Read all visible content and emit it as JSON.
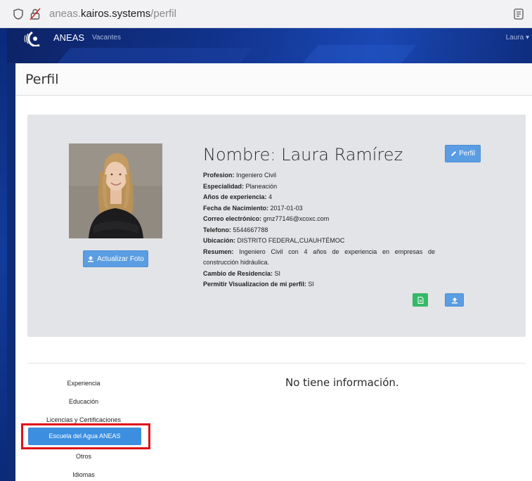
{
  "browser": {
    "url_prefix": "aneas.",
    "url_domain": "kairos.systems",
    "url_path": "/perfil"
  },
  "nav": {
    "brand": "ANEAS",
    "link": "Vacantes",
    "user": "Laura"
  },
  "page": {
    "title": "Perfil"
  },
  "profile": {
    "name": "Nombre: Laura Ramírez",
    "fields": [
      {
        "label": "Profesion:",
        "value": "Ingeniero Civil"
      },
      {
        "label": "Especialidad:",
        "value": "Planeación"
      },
      {
        "label": "Años de experiencia:",
        "value": "4"
      },
      {
        "label": "Fecha de Nacimiento:",
        "value": "2017-01-03"
      },
      {
        "label": "Correo electrónico:",
        "value": "gmz77146@xcoxc.com"
      },
      {
        "label": "Telefono:",
        "value": "5544667788"
      },
      {
        "label": "Ubicación:",
        "value": "DISTRITO FEDERAL,CUAUHTÉMOC"
      },
      {
        "label": "Resumen:",
        "value": "Ingeniero Civil con 4 años de experiencia en empresas de construcción hidráulica."
      },
      {
        "label": "Cambio de Residencia:",
        "value": "SI"
      },
      {
        "label": "Permitir Visualizacion de mi perfil:",
        "value": "SI"
      }
    ],
    "update_photo_label": "Actualizar Foto",
    "edit_profile_label": "Perfil"
  },
  "side_menu": {
    "items": [
      {
        "label": "Experiencia",
        "active": false
      },
      {
        "label": "Educación",
        "active": false
      },
      {
        "label": "Licencias y Certificaciones",
        "active": false
      },
      {
        "label": "Escuela del Agua ANEAS",
        "active": true
      },
      {
        "label": "Otros",
        "active": false
      },
      {
        "label": "Idiomas",
        "active": false
      }
    ]
  },
  "main": {
    "empty_message": "No tiene información."
  },
  "colors": {
    "primary_button": "#5a9de2",
    "success_button": "#36b868",
    "active_menu": "#3c8fe0",
    "highlight_border": "#e0101a",
    "navbar": "#11338c"
  },
  "icons": [
    "shield-icon",
    "lock-icon",
    "reader-icon",
    "upload-icon",
    "pencil-icon",
    "pdf-icon"
  ]
}
